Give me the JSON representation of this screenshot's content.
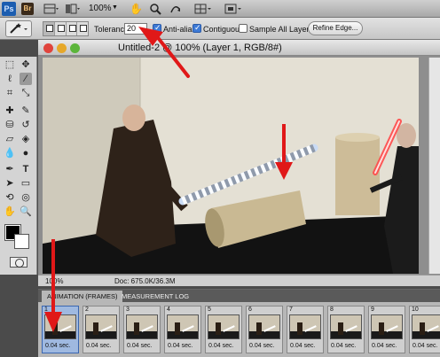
{
  "appbar": {
    "ps_logo": "Ps",
    "br_logo": "Br",
    "zoom": "100%"
  },
  "options": {
    "tolerance_label": "Tolerance:",
    "tolerance_value": "20",
    "antialias_label": "Anti-alias",
    "contiguous_label": "Contiguous",
    "sample_all_label": "Sample All Layers",
    "refine_edge_label": "Refine Edge..."
  },
  "document": {
    "title": "Untitled-2 @ 100% (Layer 1, RGB/8#)",
    "zoom": "100%",
    "doc_size": "Doc: 675.0K/36.3M"
  },
  "anim_panel": {
    "tab_frames": "ANIMATION (FRAMES)",
    "tab_measure": "MEASUREMENT LOG",
    "frames": [
      {
        "num": "1",
        "time": "0.04 sec."
      },
      {
        "num": "2",
        "time": "0.04 sec."
      },
      {
        "num": "3",
        "time": "0.04 sec."
      },
      {
        "num": "4",
        "time": "0.04 sec."
      },
      {
        "num": "5",
        "time": "0.04 sec."
      },
      {
        "num": "6",
        "time": "0.04 sec."
      },
      {
        "num": "7",
        "time": "0.04 sec."
      },
      {
        "num": "8",
        "time": "0.04 sec."
      },
      {
        "num": "9",
        "time": "0.04 sec."
      },
      {
        "num": "10",
        "time": "0.04 sec."
      }
    ]
  },
  "colors": {
    "annotation_red": "#e01818",
    "saber_red": "#ff4a4a",
    "selection_blue": "#3d7ad6"
  }
}
